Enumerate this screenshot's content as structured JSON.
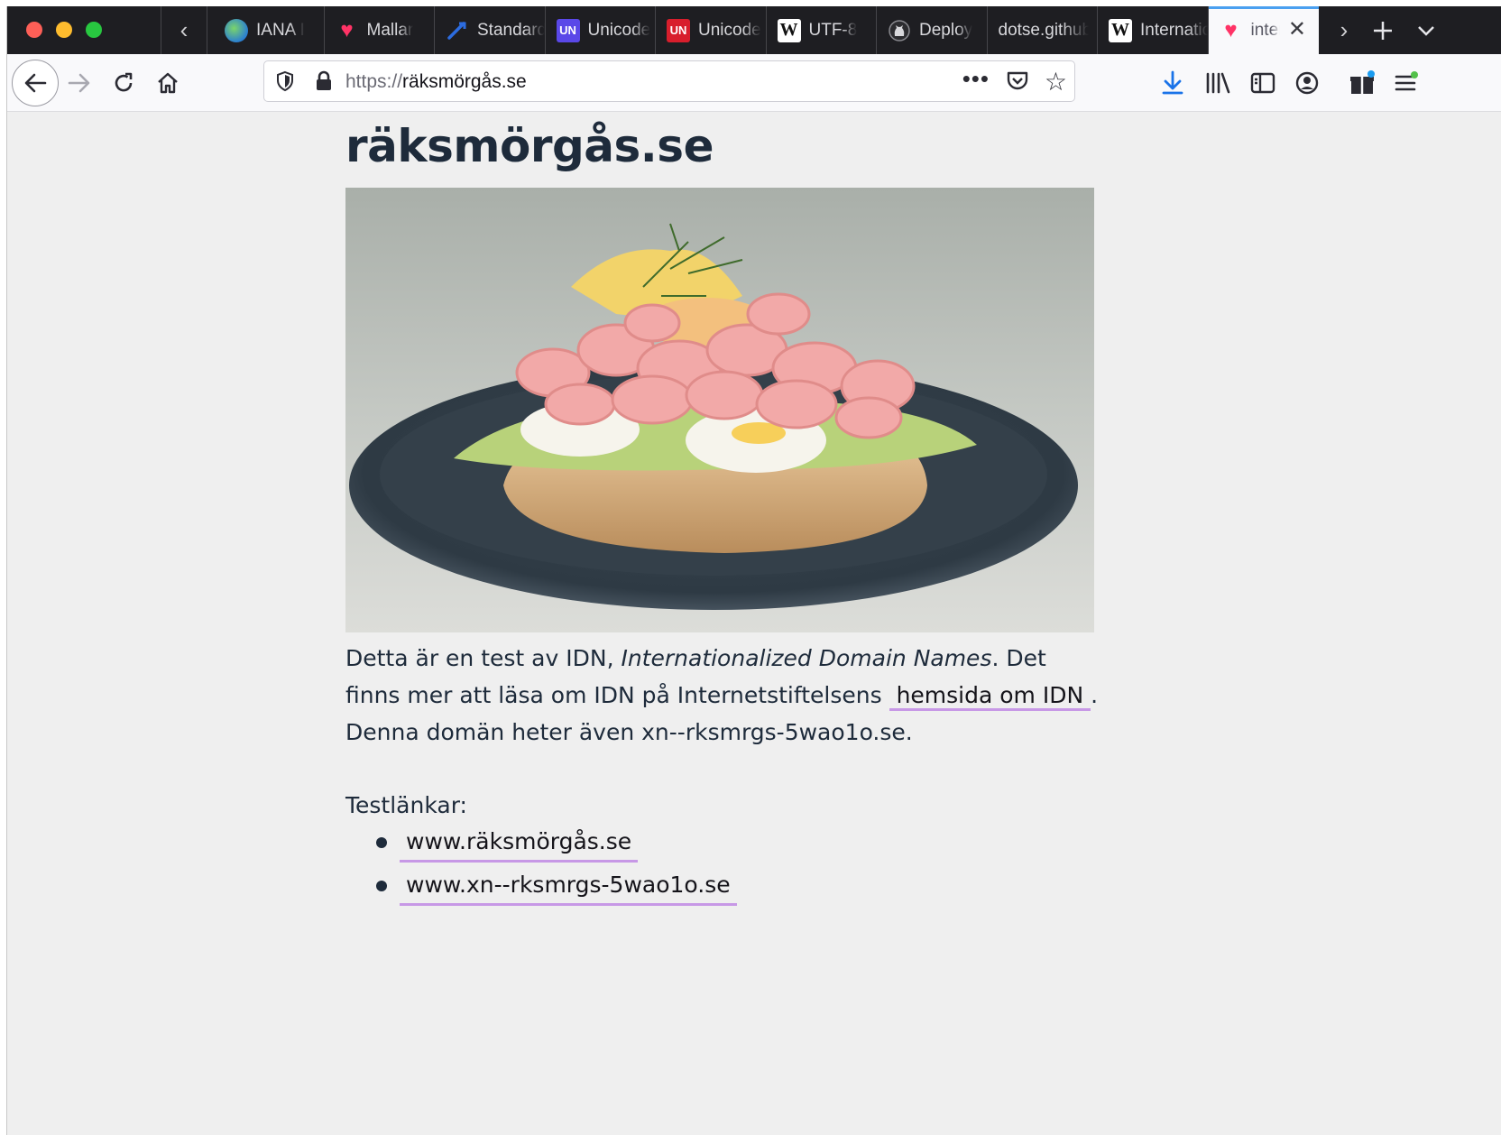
{
  "browser": {
    "tabs": [
      {
        "label": "IANA I",
        "icon": "globe-favicon-icon"
      },
      {
        "label": "Mallar",
        "icon": "heart-favicon-icon"
      },
      {
        "label": "Standards",
        "icon": "standards-favicon-icon"
      },
      {
        "label": "Unicode",
        "icon": "unicode-favicon-icon"
      },
      {
        "label": "Unicode",
        "icon": "unicode-favicon-icon"
      },
      {
        "label": "UTF-8",
        "icon": "wikipedia-favicon-icon"
      },
      {
        "label": "Deploy",
        "icon": "github-favicon-icon"
      },
      {
        "label": "dotse.github",
        "icon": ""
      },
      {
        "label": "Internationalized",
        "icon": "wikipedia-favicon-icon"
      },
      {
        "label": "internationalized",
        "icon": "heart-favicon-icon"
      }
    ],
    "favicon_text": {
      "unicode": "UN",
      "wikipedia": "W",
      "standards": "⬡"
    },
    "url": {
      "scheme": "https://",
      "host": "räksmörgås.se"
    },
    "more_glyph": "•••",
    "accent_color": "#4aa0f0",
    "link_underline_color": "#c798e6"
  },
  "page": {
    "title": "räksmörgås.se",
    "paragraph": {
      "intro": "Detta är en test av IDN, ",
      "emphasis": "Internationalized Domain Names",
      "mid": ". Det finns mer att läsa om IDN på Internetstiftelsens ",
      "link_label": "hemsida om IDN",
      "outro": ". Denna domän heter även xn--rksmrgs-5wao1o.se."
    },
    "test_label": "Testlänkar:",
    "test_links": [
      "www.räksmörgås.se",
      "www.xn--rksmrgs-5wao1o.se"
    ]
  }
}
